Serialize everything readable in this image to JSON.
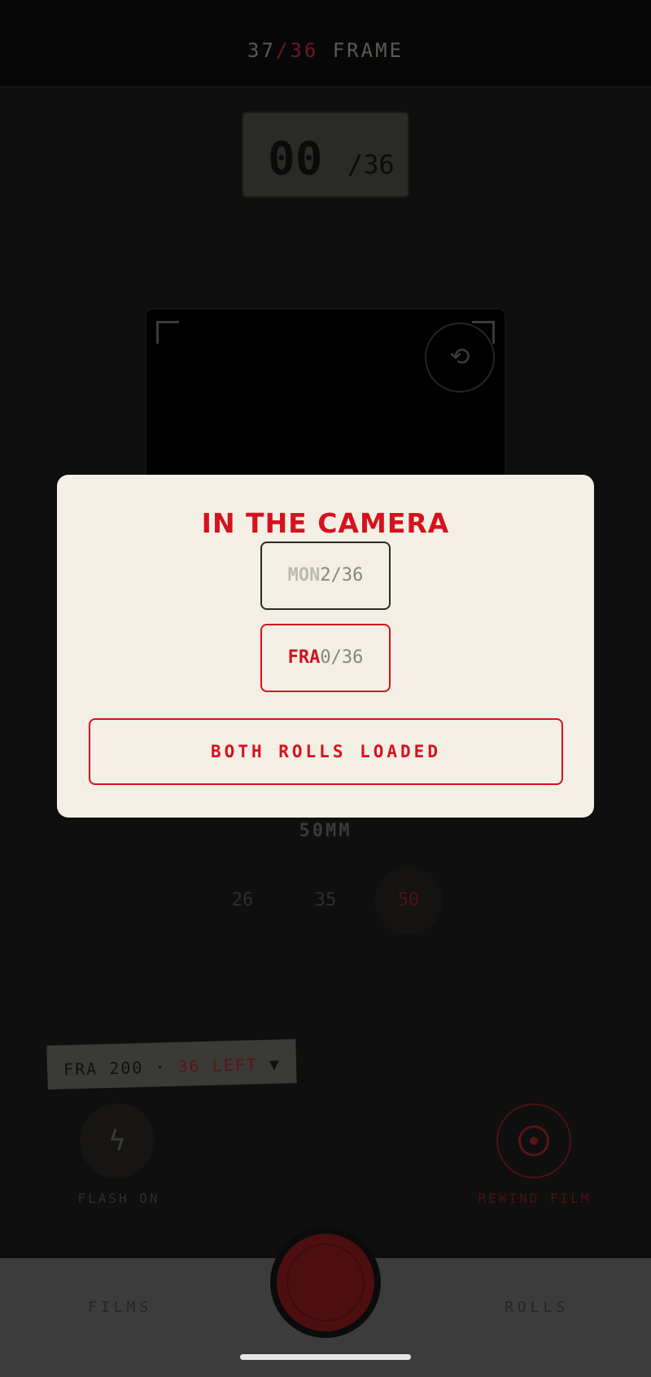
{
  "header": {
    "shot": "37",
    "slash": "/",
    "total": "36",
    "label": "FRAME"
  },
  "frame_counter": {
    "current": "00",
    "total": "/36"
  },
  "viewfinder": {
    "flip_icon": "⟲"
  },
  "lens": {
    "label": "50MM",
    "options": [
      "26",
      "35",
      "50"
    ],
    "selected": "50"
  },
  "roll_tag": {
    "film": "FRA 200",
    "sep": "·",
    "left": "36 LEFT",
    "caret": "▼"
  },
  "controls": {
    "flash_label": "FLASH ON",
    "flash_icon": "ϟ",
    "rewind_label": "REWIND FILM"
  },
  "bottom_nav": {
    "films": "FILMS",
    "rolls": "ROLLS"
  },
  "modal": {
    "title": "IN THE CAMERA",
    "rolls": [
      {
        "name": "MON",
        "count": "2/36"
      },
      {
        "name": "FRA",
        "count": "0/36"
      }
    ],
    "action": "BOTH ROLLS LOADED"
  }
}
